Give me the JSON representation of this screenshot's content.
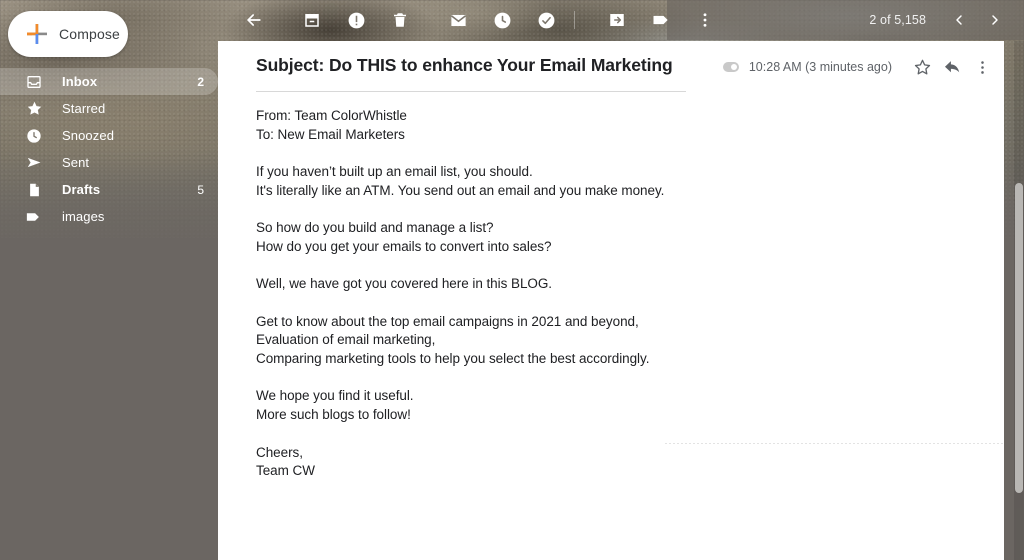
{
  "app": {
    "name": "Gmail message view",
    "background_color": "#6b6662",
    "panel_color": "#ffffff"
  },
  "compose": {
    "label": "Compose",
    "icon": "compose-pencil-icon",
    "icon_colors": [
      "#f28b2c",
      "#5b8def",
      "#8a8a8a"
    ]
  },
  "toolbar": {
    "icons": [
      {
        "name": "back-icon",
        "label": "Back to Inbox"
      },
      {
        "name": "archive-icon",
        "label": "Archive"
      },
      {
        "name": "report-spam-icon",
        "label": "Report spam"
      },
      {
        "name": "delete-icon",
        "label": "Delete"
      },
      {
        "name": "mark-unread-icon",
        "label": "Mark as unread"
      },
      {
        "name": "snooze-icon",
        "label": "Snooze"
      },
      {
        "name": "add-to-tasks-icon",
        "label": "Add to Tasks"
      },
      {
        "name": "move-to-icon",
        "label": "Move to"
      },
      {
        "name": "labels-icon",
        "label": "Labels"
      },
      {
        "name": "more-options-icon",
        "label": "More"
      }
    ],
    "pager": {
      "count_text": "2 of 5,158",
      "prev_label": "Newer",
      "next_label": "Older"
    }
  },
  "sidebar": {
    "items": [
      {
        "label": "Inbox",
        "count": "2",
        "icon": "inbox-icon",
        "active": true,
        "bold": true
      },
      {
        "label": "Starred",
        "count": "",
        "icon": "star-icon",
        "active": false,
        "bold": false
      },
      {
        "label": "Snoozed",
        "count": "",
        "icon": "clock-icon",
        "active": false,
        "bold": false
      },
      {
        "label": "Sent",
        "count": "",
        "icon": "send-icon",
        "active": false,
        "bold": false
      },
      {
        "label": "Drafts",
        "count": "5",
        "icon": "draft-icon",
        "active": false,
        "bold": true
      },
      {
        "label": "images",
        "count": "",
        "icon": "label-tag-icon",
        "active": false,
        "bold": false
      }
    ]
  },
  "email": {
    "subject": "Subject: Do THIS to enhance Your Email Marketing",
    "timestamp": "10:28 AM (3 minutes ago)",
    "header_icons": [
      {
        "name": "attachment-chip-icon",
        "label": "Attachment"
      },
      {
        "name": "star-outline-icon",
        "label": "Star"
      },
      {
        "name": "reply-icon",
        "label": "Reply"
      },
      {
        "name": "more-options-icon",
        "label": "More"
      }
    ],
    "body": [
      [
        "From: Team ColorWhistle",
        "To: New Email Marketers"
      ],
      [
        "If you haven’t built up an email list, you should.",
        "It's literally like an ATM. You send out an email and you make money."
      ],
      [
        "So how do you build and manage a list?",
        "How do you get your emails to convert into sales?"
      ],
      [
        "Well, we have got you covered here in this BLOG."
      ],
      [
        "Get to know about the top email campaigns in 2021 and beyond,",
        "Evaluation of email marketing,",
        "Comparing marketing tools to help you select the best accordingly."
      ],
      [
        "We hope you find it useful.",
        "More such blogs to follow!"
      ],
      [
        "Cheers,",
        "Team CW"
      ]
    ]
  },
  "scrollbar": {
    "thumb_color": "#b9b7b4"
  }
}
